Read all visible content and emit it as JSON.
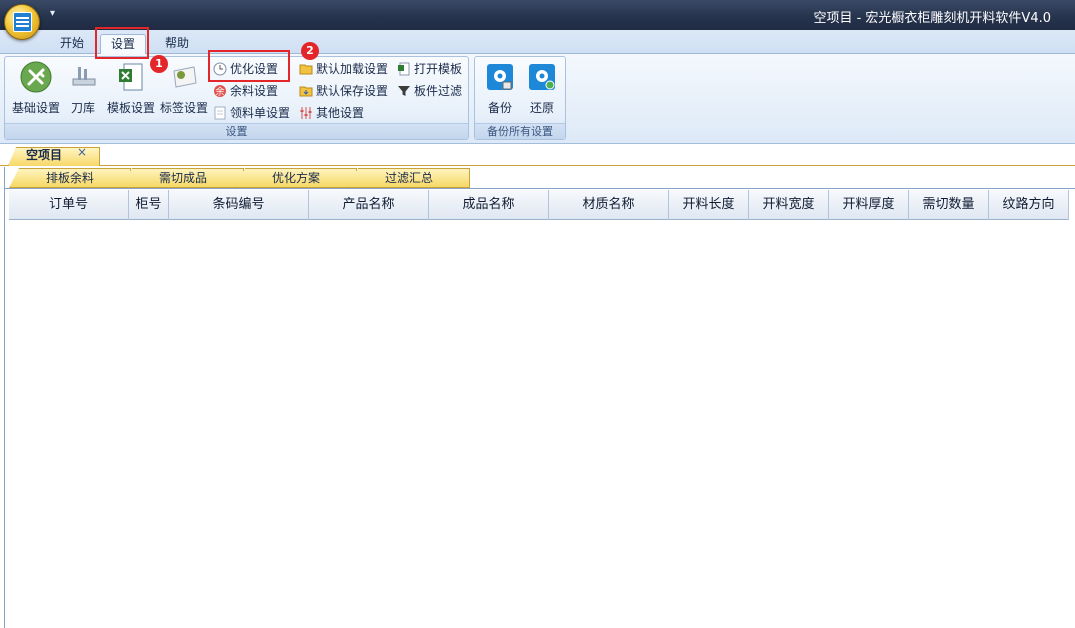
{
  "window": {
    "title": "空项目 - 宏光橱衣柜雕刻机开料软件V4.0",
    "qat_glyph": "▾"
  },
  "ribbon_tabs": [
    "开始",
    "设置",
    "帮助"
  ],
  "groups": {
    "settings": {
      "label": "设置",
      "large_buttons": [
        "基础设置",
        "刀库",
        "模板设置",
        "标签设置"
      ],
      "small_buttons": [
        "优化设置",
        "余料设置",
        "领料单设置",
        "默认加载设置",
        "默认保存设置",
        "其他设置",
        "打开模板",
        "板件过滤"
      ]
    },
    "backup": {
      "label": "备份所有设置",
      "large_buttons": [
        "备份",
        "还原"
      ]
    }
  },
  "annotations": [
    "1",
    "2"
  ],
  "document_tab": {
    "label": "空项目",
    "close": "×"
  },
  "sub_tabs": [
    "排板余料",
    "需切成品",
    "优化方案",
    "过滤汇总"
  ],
  "grid": {
    "columns": [
      "订单号",
      "柜号",
      "条码编号",
      "产品名称",
      "成品名称",
      "材质名称",
      "开料长度",
      "开料宽度",
      "开料厚度",
      "需切数量",
      "纹路方向"
    ]
  },
  "colors": {
    "annotation_red": "#e3262a",
    "tab_gold": "#f6d865",
    "ribbon_blue": "#dde9f7",
    "titlebar": "#27344e"
  }
}
